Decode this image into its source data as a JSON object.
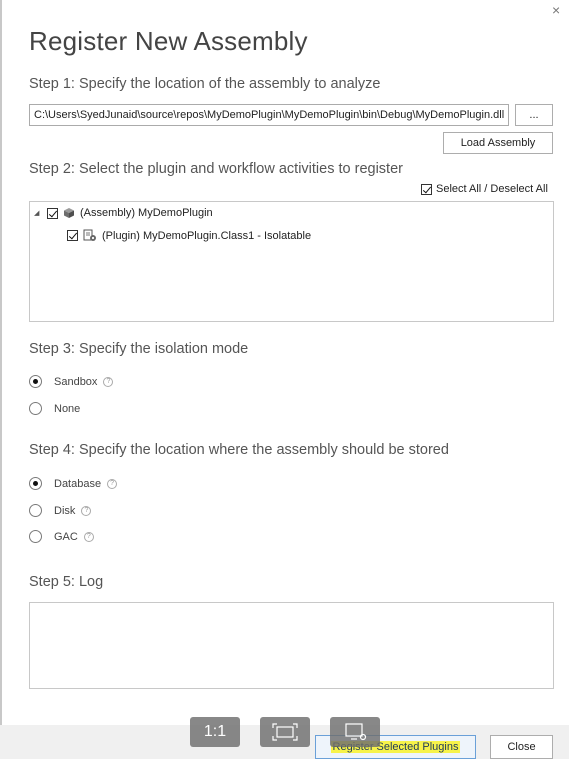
{
  "dialog": {
    "close_glyph": "×",
    "title": "Register New Assembly"
  },
  "step1": {
    "label": "Step 1: Specify the location of the assembly to analyze",
    "path_value": "C:\\Users\\SyedJunaid\\source\\repos\\MyDemoPlugin\\MyDemoPlugin\\bin\\Debug\\MyDemoPlugin.dll",
    "browse_label": "...",
    "load_label": "Load Assembly"
  },
  "step2": {
    "label": "Step 2: Select the plugin and workflow activities to register",
    "select_all_label": "Select All / Deselect All",
    "select_all_checked": true,
    "tree": [
      {
        "label": "(Assembly) MyDemoPlugin",
        "checked": true,
        "expanded": true,
        "icon": "assembly-icon"
      },
      {
        "label": "(Plugin) MyDemoPlugin.Class1 - Isolatable",
        "checked": true,
        "icon": "plugin-icon"
      }
    ]
  },
  "step3": {
    "label": "Step 3: Specify the isolation mode",
    "options": [
      {
        "label": "Sandbox",
        "selected": true,
        "help": true
      },
      {
        "label": "None",
        "selected": false,
        "help": false
      }
    ]
  },
  "step4": {
    "label": "Step 4: Specify the location where the assembly should be stored",
    "options": [
      {
        "label": "Database",
        "selected": true
      },
      {
        "label": "Disk",
        "selected": false
      },
      {
        "label": "GAC",
        "selected": false
      }
    ]
  },
  "step5": {
    "label": "Step 5: Log",
    "log_text": ""
  },
  "footer": {
    "register_label": "Register Selected Plugins",
    "close_label": "Close",
    "highlight_color": "#f7f34a"
  },
  "viewer_overlay": {
    "actual_size_label": "1:1",
    "fit_icon": "fit-to-screen-icon",
    "screen_icon": "screen-snip-icon"
  }
}
